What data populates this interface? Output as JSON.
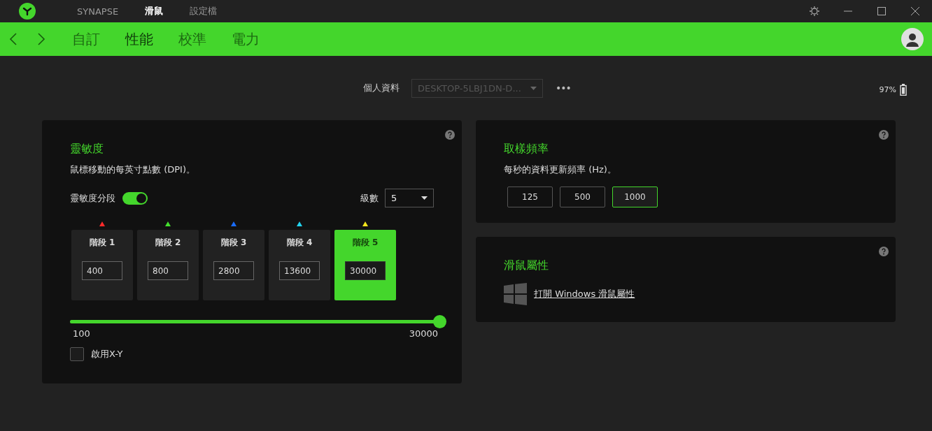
{
  "top_tabs": [
    {
      "label": "SYNAPSE",
      "selected": false
    },
    {
      "label": "滑鼠",
      "selected": true
    },
    {
      "label": "設定檔",
      "selected": false
    }
  ],
  "sub_tabs": [
    {
      "label": "自訂",
      "selected": false
    },
    {
      "label": "性能",
      "selected": true
    },
    {
      "label": "校準",
      "selected": false
    },
    {
      "label": "電力",
      "selected": false
    }
  ],
  "profile": {
    "label": "個人資料",
    "value": "DESKTOP-5LBJ1DN-D...",
    "more": "•••"
  },
  "battery": {
    "reading": "97%"
  },
  "sensitivity": {
    "title": "靈敏度",
    "description": "鼠標移動的每英寸點數 (DPI)。",
    "stages_label": "靈敏度分段",
    "stages_on": true,
    "count_label": "級數",
    "count_value": "5",
    "stages": [
      {
        "label": "階段 1",
        "value": "400",
        "color": "#ff2a2a",
        "selected": false
      },
      {
        "label": "階段 2",
        "value": "800",
        "color": "#44e02e",
        "selected": false
      },
      {
        "label": "階段 3",
        "value": "2800",
        "color": "#1a6cff",
        "selected": false
      },
      {
        "label": "階段 4",
        "value": "13600",
        "color": "#22d4f0",
        "selected": false
      },
      {
        "label": "階段 5",
        "value": "30000",
        "color": "#f2e51c",
        "selected": true
      }
    ],
    "slider": {
      "level": 1,
      "min": "100",
      "max": "30000"
    },
    "xy": {
      "label": "啟用X-Y",
      "checked": false
    }
  },
  "polling": {
    "title": "取樣頻率",
    "description": "每秒的資料更新頻率 (Hz)。",
    "options": [
      {
        "label": "125",
        "selected": false
      },
      {
        "label": "500",
        "selected": false
      },
      {
        "label": "1000",
        "selected": true
      }
    ]
  },
  "mouse_props": {
    "title": "滑鼠屬性",
    "link": "打開 Windows 滑鼠屬性"
  }
}
